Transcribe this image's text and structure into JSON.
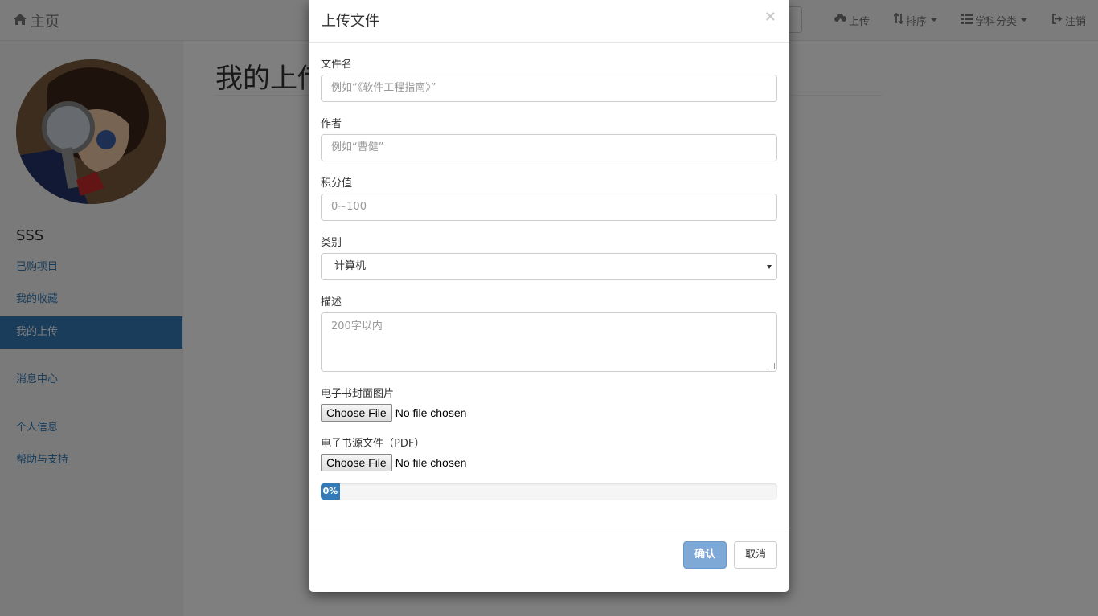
{
  "navbar": {
    "brand": "主页",
    "items": [
      {
        "label": "上传",
        "icon": "cloud-upload-icon"
      },
      {
        "label": "排序",
        "icon": "sort-icon",
        "dropdown": true
      },
      {
        "label": "学科分类",
        "icon": "list-icon",
        "dropdown": true
      },
      {
        "label": "注销",
        "icon": "logout-icon"
      }
    ]
  },
  "sidebar": {
    "username": "SSS",
    "items": [
      {
        "label": "已购项目"
      },
      {
        "label": "我的收藏"
      },
      {
        "label": "我的上传",
        "active": true
      },
      {
        "label": "消息中心"
      },
      {
        "label": "个人信息"
      },
      {
        "label": "帮助与支持"
      }
    ]
  },
  "main": {
    "title": "我的上传"
  },
  "modal": {
    "title": "上传文件",
    "close": "×",
    "fields": {
      "filename": {
        "label": "文件名",
        "placeholder": "例如“《软件工程指南》”"
      },
      "author": {
        "label": "作者",
        "placeholder": "例如“曹健”"
      },
      "points": {
        "label": "积分值",
        "placeholder": "0~100"
      },
      "category": {
        "label": "类别",
        "value": "计算机"
      },
      "description": {
        "label": "描述",
        "placeholder": "200字以内"
      },
      "cover": {
        "label": "电子书封面图片",
        "button": "Choose File",
        "status": "No file chosen"
      },
      "source": {
        "label": "电子书源文件（PDF）",
        "button": "Choose File",
        "status": "No file chosen"
      }
    },
    "progress": {
      "value": 0,
      "label": "0%"
    },
    "confirm": "确认",
    "cancel": "取消"
  },
  "colors": {
    "primary": "#337ab7",
    "primary_disabled": "#7ea8d6"
  }
}
